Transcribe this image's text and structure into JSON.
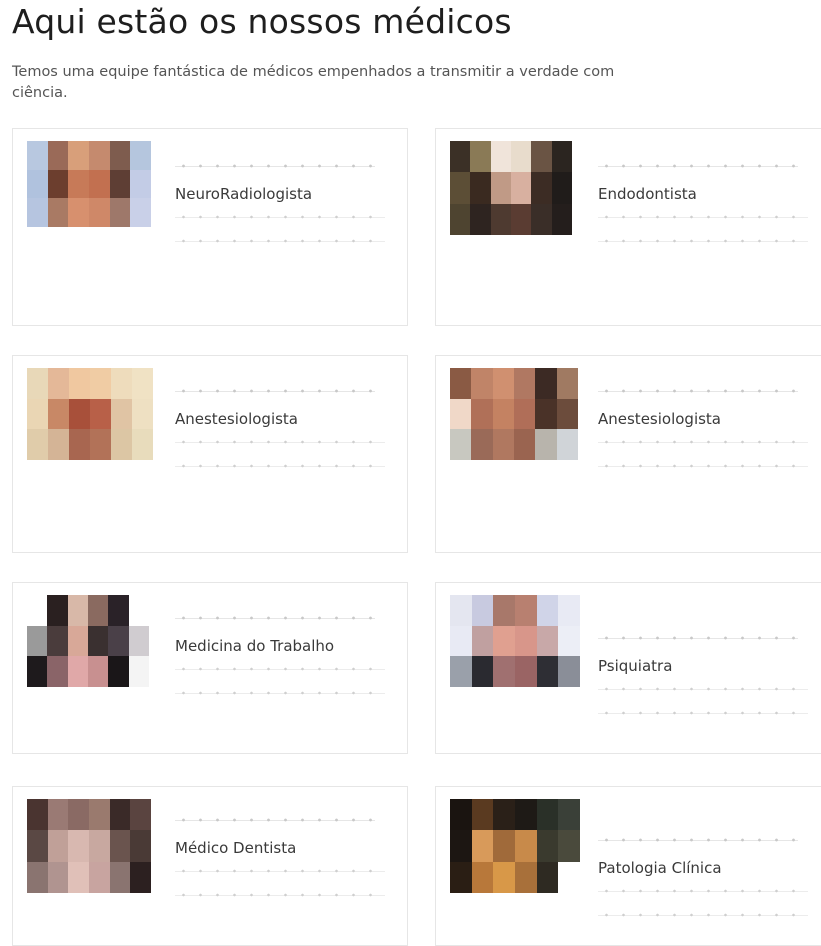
{
  "header": {
    "title": "Aqui estão os nossos médicos",
    "subtitle": "Temos uma equipe fantástica de médicos empenhados a transmitir a verdade com ciência."
  },
  "doctors": [
    {
      "specialty": "NeuroRadiologista",
      "photo_colors": [
        "#b8c8e0",
        "#9a6a58",
        "#d89f7a",
        "#c58a6e",
        "#7e5c4e",
        "#b5c6de",
        "#b0c2de",
        "#6c3e2e",
        "#c77a58",
        "#c27050",
        "#5e3e34",
        "#c3cce6",
        "#b6c5e0",
        "#a97a64",
        "#d7906e",
        "#cf8868",
        "#9e786a",
        "#c9d0e8"
      ]
    },
    {
      "specialty": "Endodontista",
      "photo_colors": [
        "#3b3026",
        "#8a7a56",
        "#f0e4da",
        "#e8dccc",
        "#6a5444",
        "#2b2520",
        "#5c4e36",
        "#3a2a20",
        "#c09a86",
        "#d8b0a0",
        "#3c2c24",
        "#201c1a",
        "#4e4430",
        "#2e2420",
        "#4e3a30",
        "#5a3c32",
        "#3a2e28",
        "#241e1c"
      ]
    },
    {
      "specialty": "Anestesiologista",
      "photo_colors": [
        "#e8d8b8",
        "#e4b898",
        "#f0c8a0",
        "#f0cca4",
        "#eedcbc",
        "#f0e2c4",
        "#ead6b4",
        "#c88866",
        "#a8503a",
        "#b86048",
        "#e0c4a4",
        "#eee0c2",
        "#e0ccaa",
        "#d4b496",
        "#a86650",
        "#b27258",
        "#dcc6a4",
        "#e8dcbc"
      ]
    },
    {
      "specialty": "Anestesiologista",
      "photo_colors": [
        "#8a5a44",
        "#c08468",
        "#d09070",
        "#b07862",
        "#3c2a24",
        "#a07a62",
        "#f0d8c8",
        "#b07058",
        "#c48262",
        "#b06e58",
        "#4a3228",
        "#6c4c3c",
        "#c8c8c0",
        "#9a6a58",
        "#b07860",
        "#9a6450",
        "#b8b4ac",
        "#d0d4d8"
      ]
    },
    {
      "specialty": "Medicina do Trabalho",
      "photo_colors": [
        "#ffffff",
        "#2a2020",
        "#d8b8a8",
        "#8a6a60",
        "#2a2228",
        "#ffffff",
        "#9a9a9a",
        "#4a3c3c",
        "#d8a898",
        "#3a3030",
        "#4a4048",
        "#d0ccd0",
        "#1e1a1c",
        "#8a6468",
        "#e0a8a8",
        "#c89090",
        "#1a1618",
        "#f4f4f4"
      ]
    },
    {
      "specialty": "Psiquiatra",
      "photo_colors": [
        "#e4e6f0",
        "#c8cae0",
        "#a8786a",
        "#b88070",
        "#d0d4e8",
        "#e8eaf4",
        "#e8eaf4",
        "#c0a0a0",
        "#e0a090",
        "#d8968a",
        "#c8a8a8",
        "#eceef6",
        "#9aa0aa",
        "#2a2a30",
        "#a07070",
        "#9a6464",
        "#2e2e34",
        "#8a8e98"
      ]
    },
    {
      "specialty": "Médico Dentista",
      "photo_colors": [
        "#4a3430",
        "#9a7a74",
        "#8a6a64",
        "#9a7a6e",
        "#3a2a28",
        "#5a4440",
        "#5a4844",
        "#c0a098",
        "#d8b8b0",
        "#c8a8a0",
        "#6a544e",
        "#4a3a36",
        "#8a7470",
        "#b09490",
        "#e0c0b8",
        "#c8a4a0",
        "#8a7470",
        "#2c2020"
      ]
    },
    {
      "specialty": "Patologia Clínica",
      "photo_colors": [
        "#1a1410",
        "#5a3a20",
        "#2a2018",
        "#1e1a16",
        "#2a3028",
        "#3a4038",
        "#1c1612",
        "#d89a5a",
        "#a06a3a",
        "#c88a4a",
        "#3a3a2e",
        "#4a4a3c",
        "#2a1e14",
        "#b8783a",
        "#d89848",
        "#a8703a",
        "#2e2a22",
        "#ffffff"
      ]
    }
  ]
}
